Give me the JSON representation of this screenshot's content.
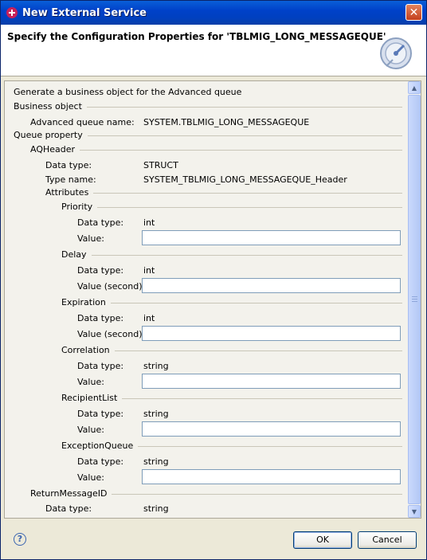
{
  "window": {
    "title": "New External Service",
    "close_glyph": "✕"
  },
  "header": {
    "title": "Specify the Configuration Properties for 'TBLMIG_LONG_MESSAGEQUE'"
  },
  "content": {
    "intro": "Generate a business object for the Advanced queue",
    "business_object": {
      "group_label": "Business object",
      "queue_name_label": "Advanced queue name:",
      "queue_name_value": "SYSTEM.TBLMIG_LONG_MESSAGEQUE"
    },
    "queue_property": {
      "group_label": "Queue property",
      "aqheader": {
        "group_label": "AQHeader",
        "data_type_label": "Data type:",
        "data_type_value": "STRUCT",
        "type_name_label": "Type name:",
        "type_name_value": "SYSTEM_TBLMIG_LONG_MESSAGEQUE_Header",
        "attributes_label": "Attributes",
        "attributes": [
          {
            "name": "Priority",
            "data_type_label": "Data type:",
            "data_type": "int",
            "value_label": "Value:",
            "value": ""
          },
          {
            "name": "Delay",
            "data_type_label": "Data type:",
            "data_type": "int",
            "value_label": "Value (second):",
            "value": ""
          },
          {
            "name": "Expiration",
            "data_type_label": "Data type:",
            "data_type": "int",
            "value_label": "Value (second):",
            "value": ""
          },
          {
            "name": "Correlation",
            "data_type_label": "Data type:",
            "data_type": "string",
            "value_label": "Value:",
            "value": ""
          },
          {
            "name": "RecipientList",
            "data_type_label": "Data type:",
            "data_type": "string",
            "value_label": "Value:",
            "value": ""
          },
          {
            "name": "ExceptionQueue",
            "data_type_label": "Data type:",
            "data_type": "string",
            "value_label": "Value:",
            "value": ""
          }
        ]
      },
      "return_message_id": {
        "group_label": "ReturnMessageID",
        "data_type_label": "Data type:",
        "data_type_value": "string"
      }
    }
  },
  "footer": {
    "help_glyph": "?",
    "ok_label": "OK",
    "cancel_label": "Cancel"
  },
  "colors": {
    "title_bar": "#0041C9",
    "dialog_bg": "#ECE9D8",
    "field_border": "#7F9DB9"
  }
}
